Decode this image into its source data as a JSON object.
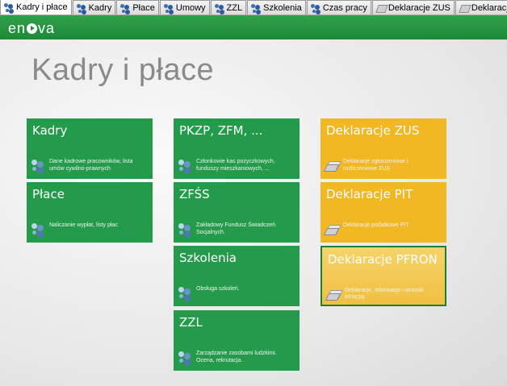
{
  "tabs": [
    {
      "label": "Kadry i płace",
      "icon": "people-icon",
      "active": true
    },
    {
      "label": "Kadry",
      "icon": "people-icon"
    },
    {
      "label": "Płace",
      "icon": "people-icon"
    },
    {
      "label": "Umowy",
      "icon": "people-icon"
    },
    {
      "label": "ZZL",
      "icon": "people-icon"
    },
    {
      "label": "Szkolenia",
      "icon": "people-icon"
    },
    {
      "label": "Czas pracy",
      "icon": "people-icon"
    },
    {
      "label": "Deklaracje ZUS",
      "icon": "document-icon"
    },
    {
      "label": "Deklaracje PFRON",
      "icon": "document-icon"
    }
  ],
  "header": {
    "logo_left": "en",
    "logo_right": "va"
  },
  "page_title": "Kadry i płace",
  "tiles": [
    {
      "title": "Kadry",
      "desc": "Dane kadrowe pracowników, lista umów cywilno-prawnych",
      "icon": "people-icon",
      "color": "#239b4b"
    },
    {
      "title": "Płace",
      "desc": "Naliczanie wypłat, listy płac",
      "icon": "people-icon",
      "color": "#239b4b"
    },
    {
      "title": "PKZP, ZFM, ...",
      "desc": "Członkowie kas pożyczkowych, funduszy mieszkaniowych, ...",
      "icon": "people-icon",
      "color": "#239b4b"
    },
    {
      "title": "ZFŚS",
      "desc": "Zakładowy Fundusz Świadczeń Socjalnych.",
      "icon": "people-icon",
      "color": "#239b4b"
    },
    {
      "title": "Szkolenia",
      "desc": "Obsługa szkoleń.",
      "icon": "people-icon",
      "color": "#239b4b"
    },
    {
      "title": "ZZL",
      "desc": "Zarządzanie zasobami ludzkimi. Ocena, rekrutacja.",
      "icon": "people-icon",
      "color": "#239b4b"
    },
    {
      "title": "Deklaracje ZUS",
      "desc": "Deklaracje zgłoszeniowe i rozliczeniowe ZUS",
      "icon": "document-icon",
      "color": "#f2b824"
    },
    {
      "title": "Deklaracje PIT",
      "desc": "Deklaracje podatkowe PIT",
      "icon": "document-icon",
      "color": "#f2b824"
    },
    {
      "title": "Deklaracje PFRON",
      "desc": "Deklaracje, informacje i wnioski PFRON",
      "icon": "document-icon",
      "color": "#f2b824",
      "selected": true
    }
  ]
}
